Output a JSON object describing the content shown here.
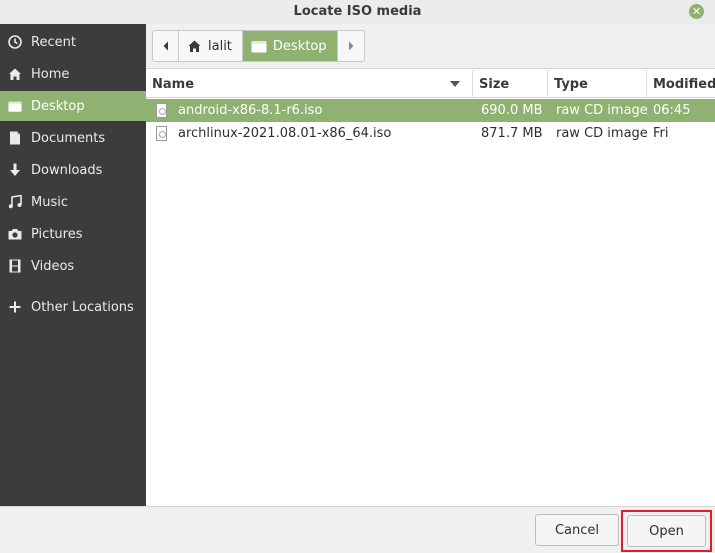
{
  "window": {
    "title": "Locate ISO media",
    "close_icon": "close-icon"
  },
  "sidebar": {
    "items": [
      {
        "label": "Recent",
        "icon": "clock-icon",
        "active": false
      },
      {
        "label": "Home",
        "icon": "home-icon",
        "active": false
      },
      {
        "label": "Desktop",
        "icon": "folder-icon",
        "active": true
      },
      {
        "label": "Documents",
        "icon": "document-icon",
        "active": false
      },
      {
        "label": "Downloads",
        "icon": "download-icon",
        "active": false
      },
      {
        "label": "Music",
        "icon": "music-icon",
        "active": false
      },
      {
        "label": "Pictures",
        "icon": "camera-icon",
        "active": false
      },
      {
        "label": "Videos",
        "icon": "film-icon",
        "active": false
      },
      {
        "label": "Other Locations",
        "icon": "plus-icon",
        "active": false
      }
    ]
  },
  "pathbar": {
    "crumbs": [
      {
        "label": "lalit",
        "icon": "home-icon"
      },
      {
        "label": "Desktop",
        "icon": "folder-icon",
        "active": true
      }
    ]
  },
  "columns": {
    "name": "Name",
    "size": "Size",
    "type": "Type",
    "modified": "Modified"
  },
  "files": [
    {
      "name": "android-x86-8.1-r6.iso",
      "size": "690.0 MB",
      "type": "raw CD image",
      "modified": "06:45",
      "selected": true
    },
    {
      "name": "archlinux-2021.08.01-x86_64.iso",
      "size": "871.7 MB",
      "type": "raw CD image",
      "modified": "Fri",
      "selected": false
    }
  ],
  "footer": {
    "cancel_label": "Cancel",
    "open_label": "Open"
  },
  "colors": {
    "accent": "#8fb171",
    "sidebar_bg": "#3c3c3c",
    "highlight_border": "#e02020"
  }
}
